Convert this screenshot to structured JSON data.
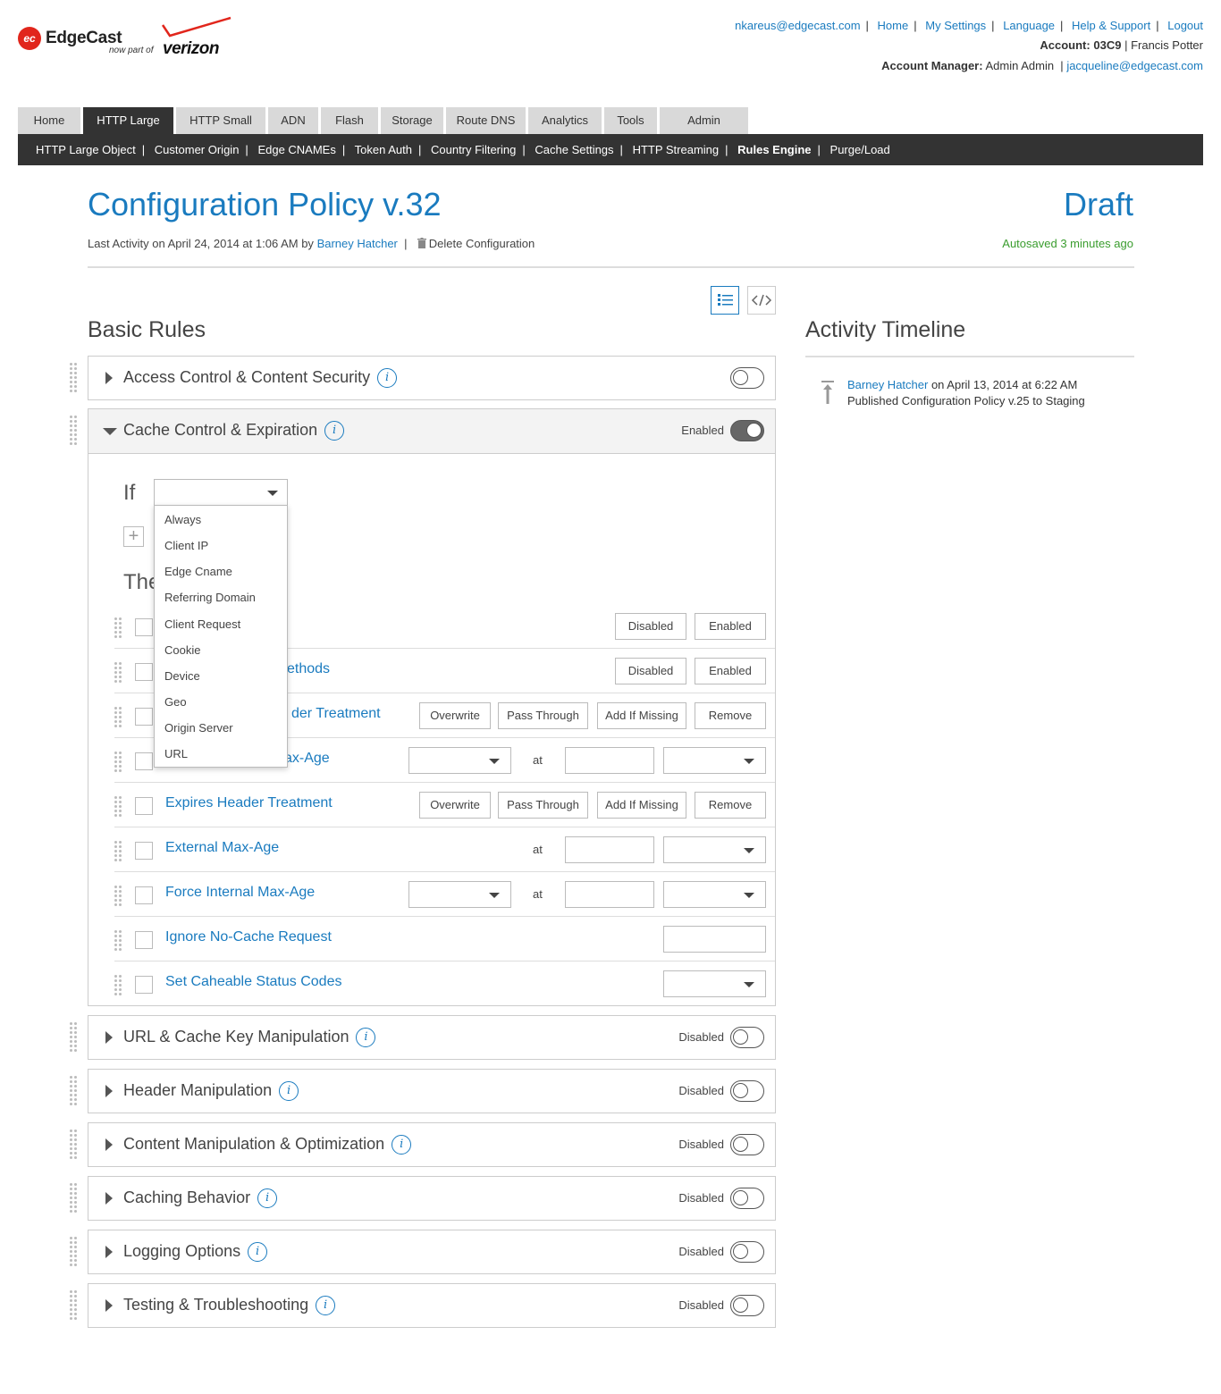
{
  "brand": {
    "logo_mark": "ec",
    "name": "EdgeCast",
    "tagline": "now part of",
    "partner": "verizon"
  },
  "top_links": [
    "nkareus@edgecast.com",
    "Home",
    "My Settings",
    "Language",
    "Help & Support",
    "Logout"
  ],
  "account": {
    "label": "Account:",
    "id": "03C9",
    "separator": "|",
    "name": "Francis Potter"
  },
  "manager": {
    "label": "Account Manager:",
    "name": "Admin Admin",
    "separator": "|",
    "email": "jacqueline@edgecast.com"
  },
  "tabs": [
    "Home",
    "HTTP Large",
    "HTTP Small",
    "ADN",
    "Flash",
    "Storage",
    "Route DNS",
    "Analytics",
    "Tools",
    "Admin"
  ],
  "active_tab": "HTTP Large",
  "subnav": [
    "HTTP Large Object",
    "Customer Origin",
    "Edge CNAMEs",
    "Token Auth",
    "Country Filtering",
    "Cache Settings",
    "HTTP Streaming",
    "Rules Engine",
    "Purge/Load"
  ],
  "active_subnav": "Rules Engine",
  "page": {
    "title": "Configuration Policy v.32",
    "status": "Draft",
    "last_activity_prefix": "Last Activity on April 24, 2014 at 1:06 AM by",
    "last_activity_user": "Barney Hatcher",
    "separator": "|",
    "delete_label": "Delete Configuration",
    "autosaved": "Autosaved 3 minutes ago"
  },
  "view_buttons": {
    "list_icon": "list-view-icon",
    "code_icon": "code-view-icon"
  },
  "basic_rules": {
    "heading": "Basic Rules"
  },
  "activity": {
    "heading": "Activity Timeline",
    "user": "Barney Hatcher",
    "when": "on April 13, 2014 at 6:22 AM",
    "line2_pre": "Published",
    "line2_item": "Configuration Policy v.25",
    "line2_post": "to Staging"
  },
  "panels": {
    "access": {
      "title": "Access Control & Content Security",
      "state": "",
      "enabled": false
    },
    "cache": {
      "title": "Cache Control & Expiration",
      "state": "Enabled",
      "enabled": true
    },
    "url": {
      "title": "URL & Cache Key Manipulation",
      "state": "Disabled",
      "enabled": false
    },
    "header": {
      "title": "Header Manipulation",
      "state": "Disabled",
      "enabled": false
    },
    "content": {
      "title": "Content Manipulation & Optimization",
      "state": "Disabled",
      "enabled": false
    },
    "caching": {
      "title": "Caching Behavior",
      "state": "Disabled",
      "enabled": false
    },
    "logging": {
      "title": "Logging Options",
      "state": "Disabled",
      "enabled": false
    },
    "testing": {
      "title": "Testing & Troubleshooting",
      "state": "Disabled",
      "enabled": false
    }
  },
  "info_glyph": "i",
  "cache_panel": {
    "if_label": "If",
    "then_label": "The",
    "plus": "+",
    "at": "at",
    "buttons": {
      "disabled": "Disabled",
      "enabled": "Enabled",
      "overwrite": "Overwrite",
      "pass_through": "Pass Through",
      "add_if_missing": "Add If Missing",
      "remove": "Remove"
    },
    "rows": [
      {
        "label": ""
      },
      {
        "label": "ethods"
      },
      {
        "label": "der Treatment"
      },
      {
        "label": "ax-Age"
      },
      {
        "label": "Expires Header Treatment"
      },
      {
        "label": "External Max-Age"
      },
      {
        "label": "Force Internal Max-Age"
      },
      {
        "label": "Ignore No-Cache Request"
      },
      {
        "label": "Set Caheable Status Codes"
      }
    ]
  },
  "if_options": [
    "Always",
    "Client IP",
    "Edge Cname",
    "Referring Domain",
    "Client Request",
    "Cookie",
    "Device",
    "Geo",
    "Origin Server",
    "URL"
  ],
  "colors": {
    "accent": "#1a7bbf",
    "nav_dark": "#333333",
    "success": "#3a9d2e",
    "brand_red": "#e1261c"
  }
}
